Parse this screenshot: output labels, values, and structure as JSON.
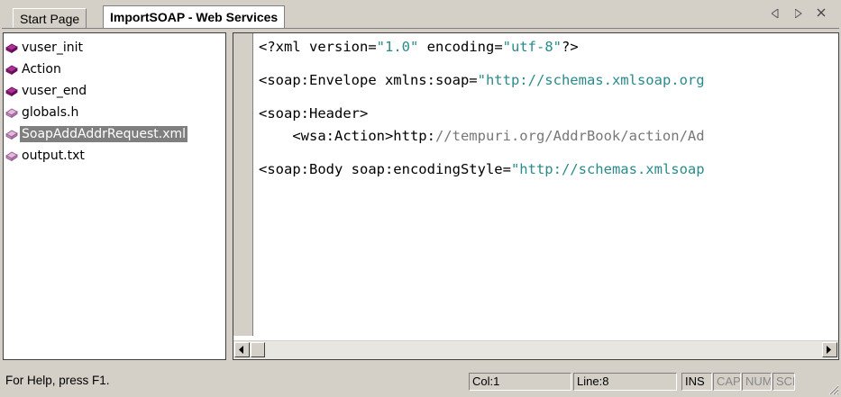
{
  "tabs": {
    "start": "Start Page",
    "active": "ImportSOAP - Web Services"
  },
  "tree": {
    "items": [
      {
        "label": "vuser_init",
        "icon": "script-icon",
        "selected": false
      },
      {
        "label": "Action",
        "icon": "script-icon",
        "selected": false
      },
      {
        "label": "vuser_end",
        "icon": "script-icon",
        "selected": false
      },
      {
        "label": "globals.h",
        "icon": "file-icon",
        "selected": false
      },
      {
        "label": "SoapAddAddrRequest.xml",
        "icon": "file-icon",
        "selected": true
      },
      {
        "label": "output.txt",
        "icon": "file-icon",
        "selected": false
      }
    ]
  },
  "editor": {
    "lines": [
      {
        "pre": "<?xml version=",
        "str": "\"1.0\"",
        "mid": " encoding=",
        "str2": "\"utf-8\"",
        "post": "?>"
      },
      {
        "gap": true
      },
      {
        "pre": "<soap:Envelope xmlns:soap=",
        "str": "\"http://schemas.xmlsoap.org"
      },
      {
        "gap": true
      },
      {
        "pre": "<soap:Header>"
      },
      {
        "pre": "    <wsa:Action>http:",
        "url": "//tempuri.org/AddrBook/action/Ad"
      },
      {
        "gap": true
      },
      {
        "pre": "<soap:Body soap:encodingStyle=",
        "str": "\"http://schemas.xmlsoap"
      }
    ]
  },
  "status": {
    "help": "For Help, press F1.",
    "col": "Col:1",
    "line": "Line:8",
    "ins": "INS",
    "cap": "CAP",
    "num": "NUM",
    "scr": "SCF"
  },
  "colors": {
    "string": "#2a8a8a",
    "comment_url": "#777777",
    "selection": "#7f7f7f",
    "chrome": "#d4d0c8",
    "script_icon": "#b0309a"
  }
}
